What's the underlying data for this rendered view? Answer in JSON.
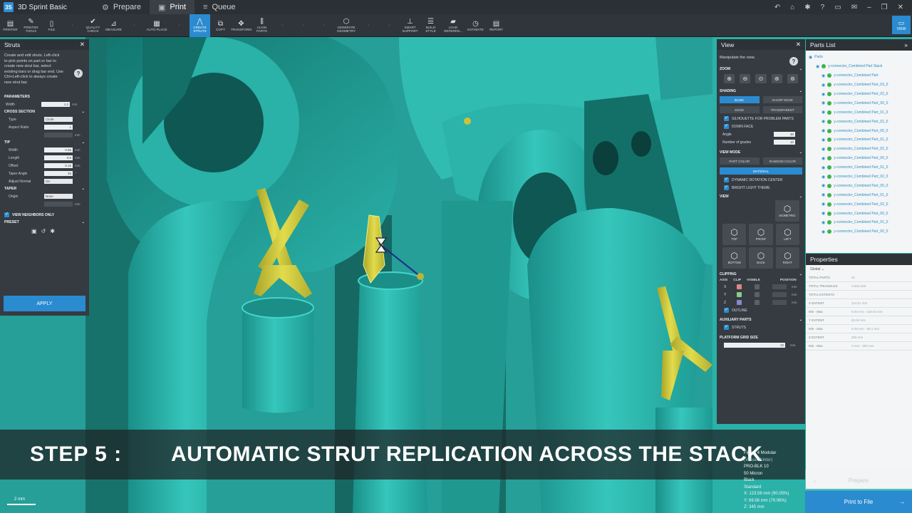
{
  "app": {
    "name": "3D Sprint Basic",
    "logo": "3S"
  },
  "main_tabs": [
    {
      "label": "Prepare",
      "icon": "prepare-icon"
    },
    {
      "label": "Print",
      "icon": "print-icon"
    },
    {
      "label": "Queue",
      "icon": "queue-icon"
    }
  ],
  "toolbar": {
    "items": [
      "PRINTER",
      "PRINTER TOOLS",
      "FILE",
      "",
      "QUALITY CHECK",
      "MEASURE",
      "",
      "AUTO PLACE",
      "",
      "CREATE STRUTS",
      "COPY",
      "TRANSFORM",
      "ALIGN PARTS",
      "",
      "",
      "",
      "GENERATE GEOMETRY",
      "",
      "",
      "SMART SUPPORT",
      "BUILD STYLE",
      "LOAD REFEREN...",
      "ESTIMATE",
      "REPORT"
    ],
    "view_label": "VIEW"
  },
  "struts": {
    "title": "Struts",
    "description": "Create and edit struts. Left-click to pick points on part or bar to create new strut bar, select existing bars or drag bar end. Use Ctrl+Left-click to always create new strut bar.",
    "parameters_label": "PARAMETERS",
    "width_label": "Width",
    "width_value": "1.2",
    "unit_mm": "mm",
    "cross_section_label": "CROSS SECTION",
    "type_label": "Type",
    "type_value": "Circle",
    "aspect_ratio_label": "Aspect Ratio",
    "aspect_ratio_value": "1",
    "tip_label": "TIP",
    "tip_width_label": "Width",
    "tip_width_value": "0.85",
    "tip_length_label": "Length",
    "tip_length_value": "0.6",
    "tip_offset_label": "Offset",
    "tip_offset_value": "0.15",
    "taper_angle_label": "Taper Angle",
    "taper_angle_value": "25",
    "taper_angle_unit": "°",
    "adjust_normal_label": "Adjust Normal",
    "adjust_normal_value": "On",
    "taper_label": "TAPER",
    "origin_label": "Origin",
    "origin_value": "None",
    "view_neighbors_label": "VIEW NEIGHBORS ONLY",
    "preset_label": "PRESET",
    "apply_label": "APPLY"
  },
  "view_panel": {
    "title": "View",
    "description": "Manipulate the view.",
    "zoom_label": "ZOOM",
    "shading_label": "SHADING",
    "shading_options": [
      "BASIC",
      "SHARP EDGE",
      "EDGE",
      "TRANSPARENT"
    ],
    "silhouette_label": "SILHOUETTE FOR PROBLEM PARTS",
    "down_face_label": "DOWN FACE",
    "angle_label": "Angle",
    "angle_value": "30",
    "grades_label": "Number of grades",
    "grades_value": "10",
    "view_mode_label": "VIEW MODE",
    "view_mode_options": [
      "PART COLOR",
      "RANDOM COLOR",
      "MATERIAL"
    ],
    "dynamic_rotation_label": "DYNAMIC ROTATION CENTER",
    "bright_light_label": "BRIGHT LIGHT THEME",
    "view_label": "VIEW",
    "isometric_label": "ISOMETRIC",
    "views": [
      "TOP",
      "FRONT",
      "LEFT",
      "BOTTOM",
      "BACK",
      "RIGHT"
    ],
    "clipping_label": "CLIPPING",
    "clip_headers": [
      "AXIS",
      "CLIP",
      "VISIBLE",
      "POSITION"
    ],
    "axes": [
      "X",
      "Y",
      "Z"
    ],
    "outline_label": "OUTLINE",
    "aux_parts_label": "AUXILIARY PARTS",
    "struts_label": "STRUTS",
    "grid_size_label": "PLATFORM GRID SIZE",
    "grid_size_value": "10",
    "grid_unit": "mm"
  },
  "parts_list": {
    "title": "Parts List",
    "root": "Parts",
    "stack": "y-connector_Combined Part Stack",
    "items": [
      "y-connector_Combined Part",
      "y-connector_Combined Part_03_0",
      "y-connector_Combined Part_02_0",
      "y-connector_Combined Part_00_0",
      "y-connector_Combined Part_01_0",
      "y-connector_Combined Part_02_0",
      "y-connector_Combined Part_00_0",
      "y-connector_Combined Part_01_0",
      "y-connector_Combined Part_02_0",
      "y-connector_Combined Part_00_0",
      "y-connector_Combined Part_01_0",
      "y-connector_Combined Part_02_0",
      "y-connector_Combined Part_00_0",
      "y-connector_Combined Part_01_0",
      "y-connector_Combined Part_02_0",
      "y-connector_Combined Part_00_0",
      "y-connector_Combined Part_01_0",
      "y-connector_Combined Part_00_0"
    ]
  },
  "properties": {
    "title": "Properties",
    "scope": "Global",
    "rows": [
      {
        "k": "TOTAL PARTS",
        "v": "31"
      },
      {
        "k": "TOTAL TRIANGLES",
        "v": "3,964,528"
      },
      {
        "k": "TOTAL EXTENTS",
        "v": ""
      },
      {
        "k": "X EXTENT",
        "v": "113.51 mm"
      },
      {
        "k": "Min - Max",
        "v": "5.03 mm - 118.54 mm"
      },
      {
        "k": "Y EXTENT",
        "v": "83.04 mm"
      },
      {
        "k": "Min - Max",
        "v": "5.46 mm - 88.1 mm"
      },
      {
        "k": "Z EXTENT",
        "v": "300 mm"
      },
      {
        "k": "Min - Max",
        "v": "0 mm - 300 mm"
      }
    ]
  },
  "banner": {
    "step": "STEP 5 :",
    "text": "AUTOMATIC STRUT REPLICATION ACROSS THE STACK"
  },
  "printer_info": {
    "name": "Figure 4 Modular",
    "virtual": "(Virtual Printer)",
    "material": "PRO-BLK 10",
    "layer": "50 Micron",
    "color": "Black",
    "style": "Standard",
    "x": "X: 123.56 mm (90.05%)",
    "y": "Y: 69.56 mm (79.06%)",
    "z": "Z: 345 mm"
  },
  "footer": {
    "prepare_label": "Prepare",
    "print_file_label": "Print to File",
    "scale": "2 mm"
  },
  "colors": {
    "accent": "#2b8bd0",
    "part": "#2ab1a8",
    "strut": "#c9c43a",
    "panel": "#353b41"
  }
}
